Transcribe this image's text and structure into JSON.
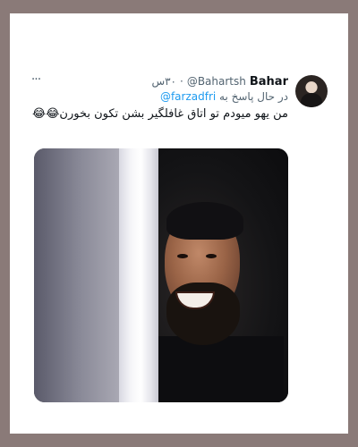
{
  "tweet": {
    "display_name": "Bahar",
    "handle": "@Bahartsh",
    "separator": "·",
    "time": "۳۰س",
    "reply_prefix": "در حال پاسخ به",
    "reply_handle": "@farzadfri",
    "text": "من یهو میودم تو اتاق غافلگیر بشن تکون بخورن😂😂",
    "more_icon": "···"
  },
  "colors": {
    "background": "#8a7a78",
    "card": "#ffffff",
    "link": "#1d9bf0",
    "muted": "#536471",
    "text": "#0f1419"
  }
}
